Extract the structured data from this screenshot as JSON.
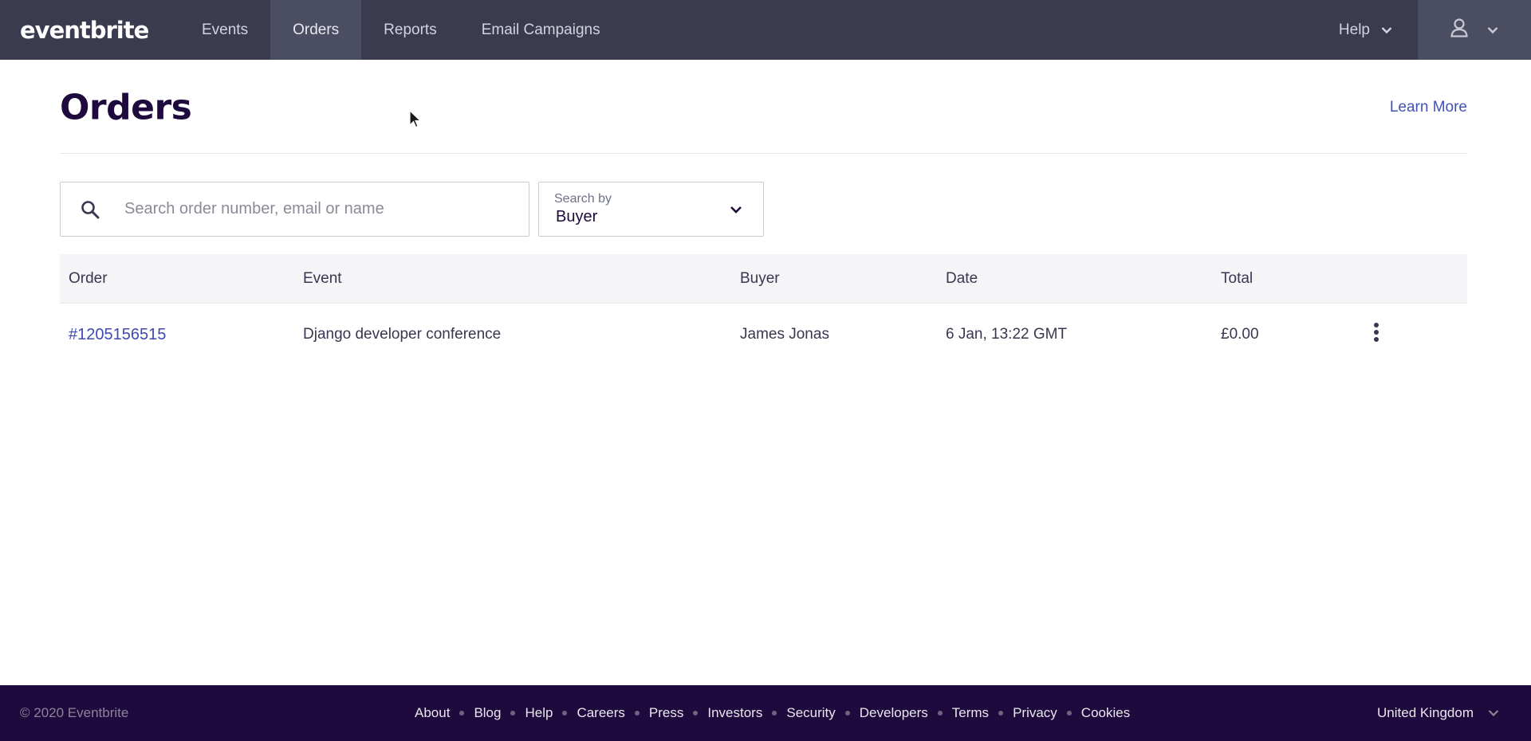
{
  "brand": {
    "logo_text": "eventbrite"
  },
  "nav": {
    "items": [
      {
        "label": "Events"
      },
      {
        "label": "Orders",
        "active": true
      },
      {
        "label": "Reports"
      },
      {
        "label": "Email Campaigns"
      }
    ],
    "help_label": "Help"
  },
  "page": {
    "title": "Orders",
    "learn_more": "Learn More"
  },
  "search": {
    "placeholder": "Search order number, email or name",
    "value": "",
    "searchby_label": "Search by",
    "searchby_value": "Buyer"
  },
  "table": {
    "headers": {
      "order": "Order",
      "event": "Event",
      "buyer": "Buyer",
      "date": "Date",
      "total": "Total"
    },
    "rows": [
      {
        "order": "#1205156515",
        "event": "Django developer conference",
        "buyer": "James Jonas",
        "date": "6 Jan, 13:22 GMT",
        "total": "£0.00"
      }
    ]
  },
  "footer": {
    "copyright": "© 2020 Eventbrite",
    "links": [
      "About",
      "Blog",
      "Help",
      "Careers",
      "Press",
      "Investors",
      "Security",
      "Developers",
      "Terms",
      "Privacy",
      "Cookies"
    ],
    "country": "United Kingdom"
  },
  "colors": {
    "nav_bg": "#3a3b4f",
    "nav_active_bg": "#4b4d63",
    "footer_bg": "#1e0a3c",
    "link": "#4251b5",
    "title": "#1e0a3c"
  },
  "icons": [
    "search-icon",
    "chevron-down-icon",
    "user-icon",
    "more-vertical-icon",
    "mouse-cursor-icon"
  ]
}
